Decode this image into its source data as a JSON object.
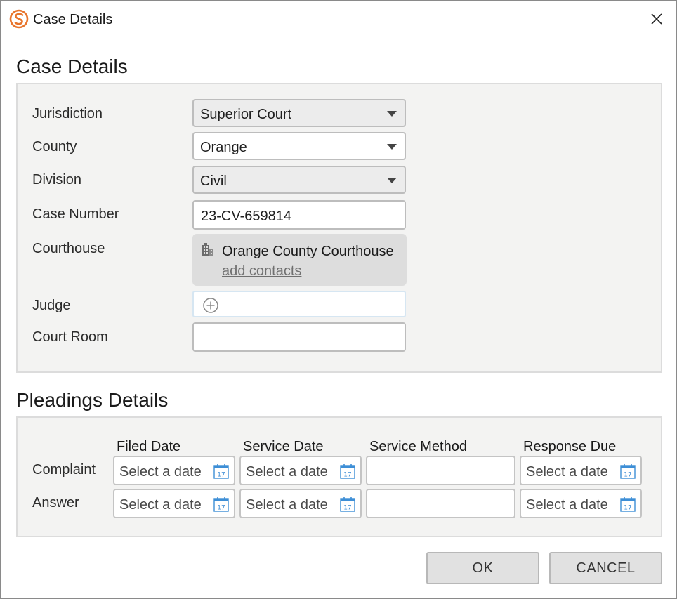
{
  "window": {
    "title": "Case Details",
    "logo_icon": "app-logo-icon",
    "close_icon": "close-icon",
    "accent_color": "#e8742b"
  },
  "case_section": {
    "heading": "Case Details",
    "fields": {
      "jurisdiction": {
        "label": "Jurisdiction",
        "value": "Superior Court"
      },
      "county": {
        "label": "County",
        "value": "Orange"
      },
      "division": {
        "label": "Division",
        "value": "Civil"
      },
      "case_number": {
        "label": "Case Number",
        "value": "23-CV-659814"
      },
      "courthouse": {
        "label": "Courthouse",
        "name": "Orange County Courthouse",
        "link": "add contacts",
        "icon": "building-icon"
      },
      "judge": {
        "label": "Judge",
        "icon": "add-circle-icon"
      },
      "court_room": {
        "label": "Court Room",
        "value": ""
      }
    }
  },
  "pleadings_section": {
    "heading": "Pleadings Details",
    "columns": [
      "Filed Date",
      "Service Date",
      "Service Method",
      "Response Due"
    ],
    "rows": [
      {
        "label": "Complaint",
        "filed": "Select a date",
        "service": "Select a date",
        "method": "",
        "response": "Select a date"
      },
      {
        "label": "Answer",
        "filed": "Select a date",
        "service": "Select a date",
        "method": "",
        "response": "Select a date"
      }
    ],
    "calendar_icon": "calendar-icon",
    "calendar_day": "17"
  },
  "buttons": {
    "ok": "OK",
    "cancel": "CANCEL"
  }
}
